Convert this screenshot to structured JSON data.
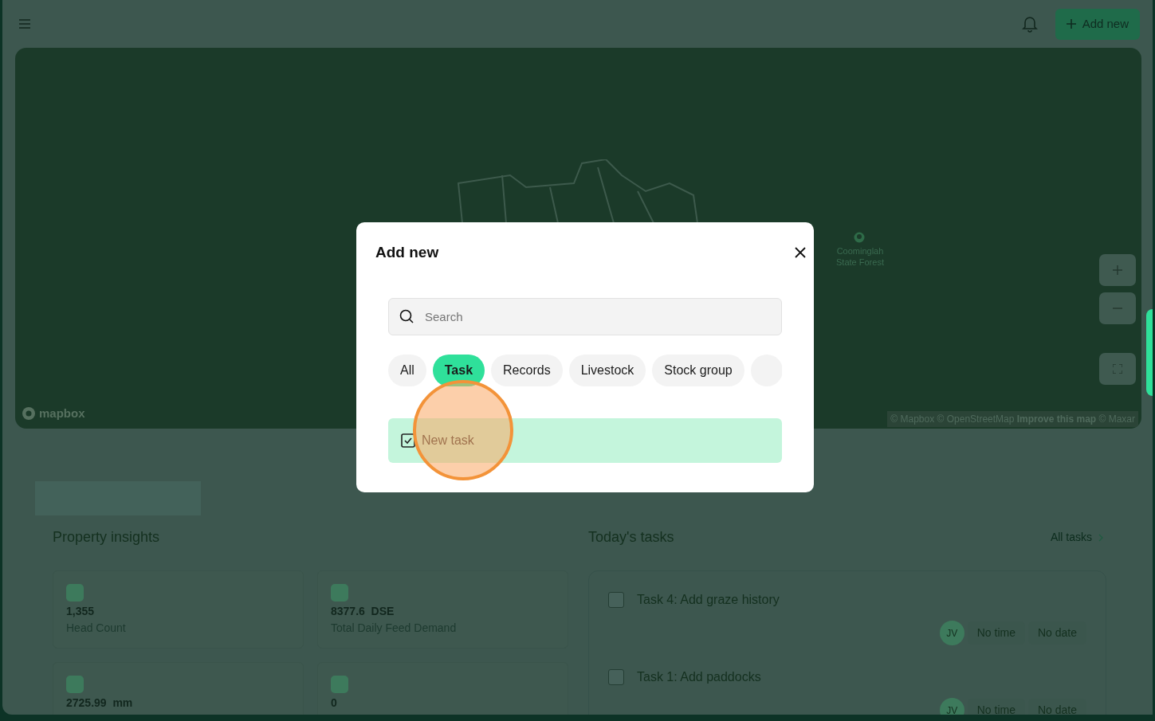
{
  "topbar": {
    "add_button": "Add new"
  },
  "map": {
    "place_label": "Coominglah State Forest",
    "logo": "mapbox",
    "attribution": "© Mapbox © OpenStreetMap **Improve this map** © Maxar"
  },
  "insights": {
    "title": "Property insights",
    "cards": [
      {
        "value": "1,355",
        "label": "Head Count"
      },
      {
        "value": "8377.6  DSE",
        "label": "Total Daily Feed Demand"
      },
      {
        "value": "2725.99  mm"
      },
      {
        "value": "0"
      }
    ]
  },
  "tasks": {
    "title": "Today's tasks",
    "link": "All tasks",
    "items": [
      {
        "title": "Task 4: Add graze history",
        "checked": false,
        "assignee": "JV",
        "time": "No time",
        "date": "No date"
      },
      {
        "title": "Task 1: Add paddocks",
        "checked": false,
        "assignee": "JV",
        "time": "No time",
        "date": "No date"
      }
    ]
  },
  "modal": {
    "title": "Add new",
    "search": {
      "placeholder": "Search"
    },
    "chips": [
      {
        "label": "All",
        "selected": false
      },
      {
        "label": "Task",
        "selected": true
      },
      {
        "label": "Records",
        "selected": false
      },
      {
        "label": "Livestock",
        "selected": false
      },
      {
        "label": "Stock group",
        "selected": false
      }
    ],
    "results": [
      {
        "label": "New task"
      }
    ]
  }
}
